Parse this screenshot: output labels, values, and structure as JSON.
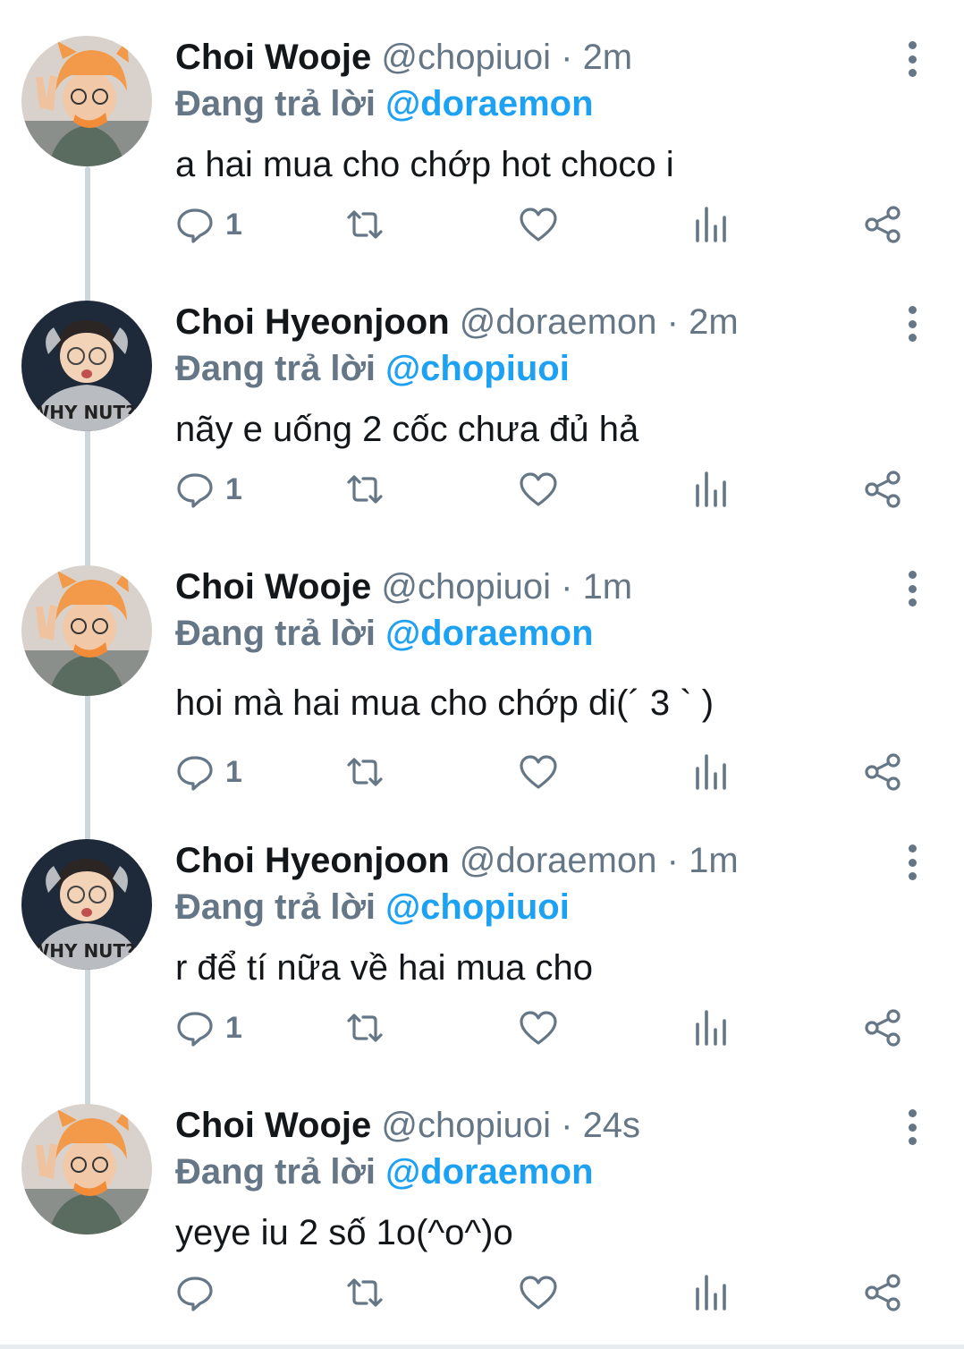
{
  "colors": {
    "accent": "#1da1f2",
    "muted": "#657786",
    "text": "#14171a",
    "line": "#ccd6dd"
  },
  "reply_prefix": "Đang trả lời",
  "separator": "·",
  "tweets": [
    {
      "name": "Choi Wooje",
      "handle": "@chopiuoi",
      "time": "2m",
      "reply_to": "@doraemon",
      "text": "a hai mua cho chớp hot choco i",
      "reply_count": "1",
      "avatar": "wooje-avatar"
    },
    {
      "name": "Choi Hyeonjoon",
      "handle": "@doraemon",
      "time": "2m",
      "reply_to": "@chopiuoi",
      "text": "nãy e uống 2 cốc chưa đủ hả",
      "reply_count": "1",
      "avatar": "hyeonjoon-avatar",
      "shirt_text": "WHY NUT?!"
    },
    {
      "name": "Choi Wooje",
      "handle": "@chopiuoi",
      "time": "1m",
      "reply_to": "@doraemon",
      "text": "hoi mà hai mua cho chớp di(´ 3 ` )",
      "reply_count": "1",
      "avatar": "wooje-avatar"
    },
    {
      "name": "Choi Hyeonjoon",
      "handle": "@doraemon",
      "time": "1m",
      "reply_to": "@chopiuoi",
      "text": "r để tí nữa về hai mua cho",
      "reply_count": "1",
      "avatar": "hyeonjoon-avatar",
      "shirt_text": "WHY NUT?!"
    },
    {
      "name": "Choi Wooje",
      "handle": "@chopiuoi",
      "time": "24s",
      "reply_to": "@doraemon",
      "text": "yeye iu 2 số 1o(^o^)o",
      "reply_count": "",
      "avatar": "wooje-avatar"
    }
  ]
}
